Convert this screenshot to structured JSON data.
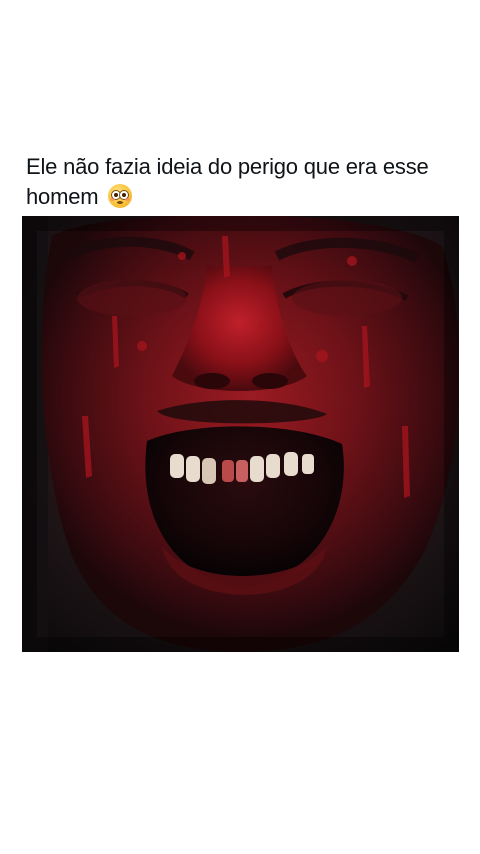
{
  "post": {
    "text": "Ele não fazia ideia do perigo que era esse homem",
    "emoji": "flushed-face-emoji"
  },
  "media": {
    "type": "image",
    "description_icon": "blood-covered-screaming-face-image"
  },
  "colors": {
    "background": "#ffffff",
    "text": "#0f1419",
    "blood": "#7a0d14"
  }
}
